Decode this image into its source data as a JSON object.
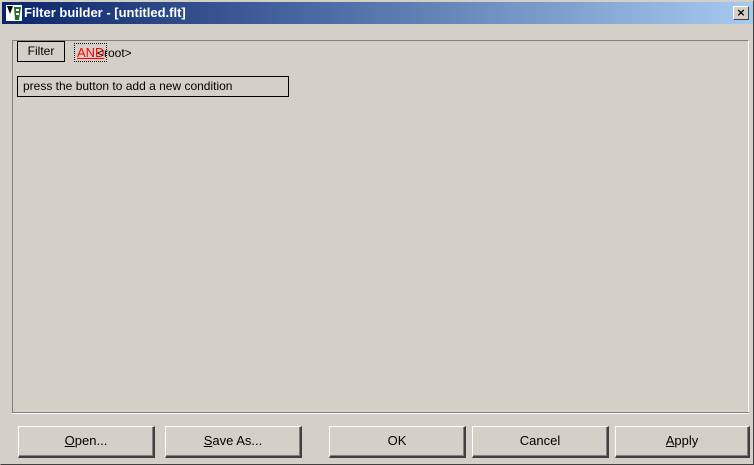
{
  "window": {
    "title": "Filter builder - [untitled.flt]",
    "close_glyph": "×"
  },
  "builder": {
    "filter_button_label": "Filter",
    "group_operator": "AND",
    "root_label": "<root>",
    "add_condition_hint": "press the button to add a new condition"
  },
  "buttons": {
    "open": {
      "mnemonic": "O",
      "rest": "pen..."
    },
    "save_as": {
      "mnemonic": "S",
      "rest": "ave As..."
    },
    "ok": "OK",
    "cancel": "Cancel",
    "apply": {
      "mnemonic": "A",
      "rest": "pply"
    }
  },
  "colors": {
    "title_gradient_start": "#0a246a",
    "title_gradient_end": "#a6caf0",
    "face": "#d4d0c8",
    "operator_text": "#ff0000"
  },
  "icons": {
    "app": "filter-builder-app-icon",
    "close": "close-icon"
  }
}
